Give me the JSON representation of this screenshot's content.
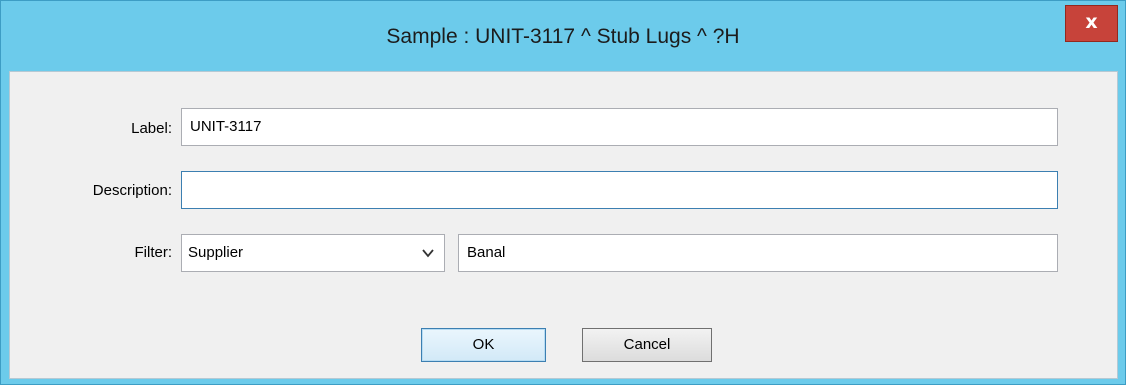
{
  "window": {
    "title": "Sample : UNIT-3117 ^ Stub Lugs ^ ?H",
    "close_label": "x"
  },
  "form": {
    "label_caption": "Label:",
    "label_value": "UNIT-3117",
    "description_caption": "Description:",
    "description_value": "",
    "filter_caption": "Filter:",
    "filter_selected": "Supplier",
    "filter_value": "Banal"
  },
  "buttons": {
    "ok": "OK",
    "cancel": "Cancel"
  },
  "colors": {
    "titlebar": "#6ccbeb",
    "close_button": "#c7433a",
    "client_background": "#f0f0f0",
    "focus_border": "#3c7fb1"
  },
  "icons": {
    "close": "close-icon",
    "dropdown": "chevron-down-icon"
  }
}
